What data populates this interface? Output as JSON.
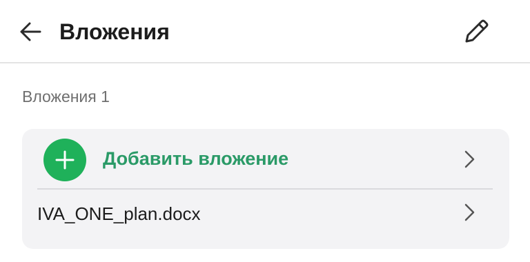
{
  "header": {
    "title": "Вложения",
    "back_icon": "arrow-left-icon",
    "edit_icon": "pencil-icon"
  },
  "section": {
    "label": "Вложения 1"
  },
  "attachments": {
    "add_label": "Добавить вложение",
    "add_icon": "plus-icon",
    "items": [
      {
        "name": "IVA_ONE_plan.docx"
      }
    ]
  },
  "colors": {
    "accent_green": "#1fb15a",
    "accent_text": "#2a9a67",
    "card_bg": "#f3f3f5"
  }
}
